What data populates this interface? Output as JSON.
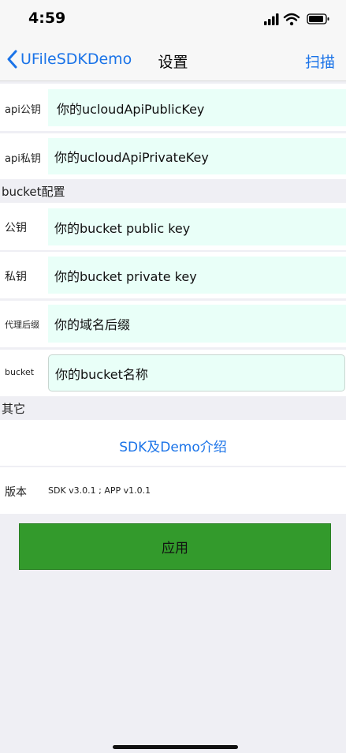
{
  "status_bar": {
    "time": "4:59"
  },
  "nav": {
    "back_label": "UFileSDKDemo",
    "title": "设置",
    "right_button": "扫描"
  },
  "api_rows": [
    {
      "label": "api公钥",
      "value": "你的ucloudApiPublicKey"
    },
    {
      "label": "api私钥",
      "value": "你的ucloudApiPrivateKey"
    }
  ],
  "bucket_section": {
    "header": "bucket配置",
    "rows": [
      {
        "label": "公钥",
        "value": "你的bucket public key"
      },
      {
        "label": "私钥",
        "value": "你的bucket private key"
      },
      {
        "label": "代理后缀",
        "value": "你的域名后缀"
      },
      {
        "label": "bucket",
        "value": "你的bucket名称"
      }
    ]
  },
  "other_section": {
    "header": "其它",
    "intro_link": "SDK及Demo介绍",
    "version_label": "版本",
    "version_value": "SDK v3.0.1 ; APP v1.0.1"
  },
  "apply_button": "应用",
  "colors": {
    "accent_blue": "#1a73e8",
    "apply_green": "#339a2c",
    "input_bg": "#e9fff8",
    "page_bg": "#efeff4"
  },
  "icons": [
    "chevron-left-icon",
    "cellular-signal-icon",
    "wifi-icon",
    "battery-icon"
  ]
}
